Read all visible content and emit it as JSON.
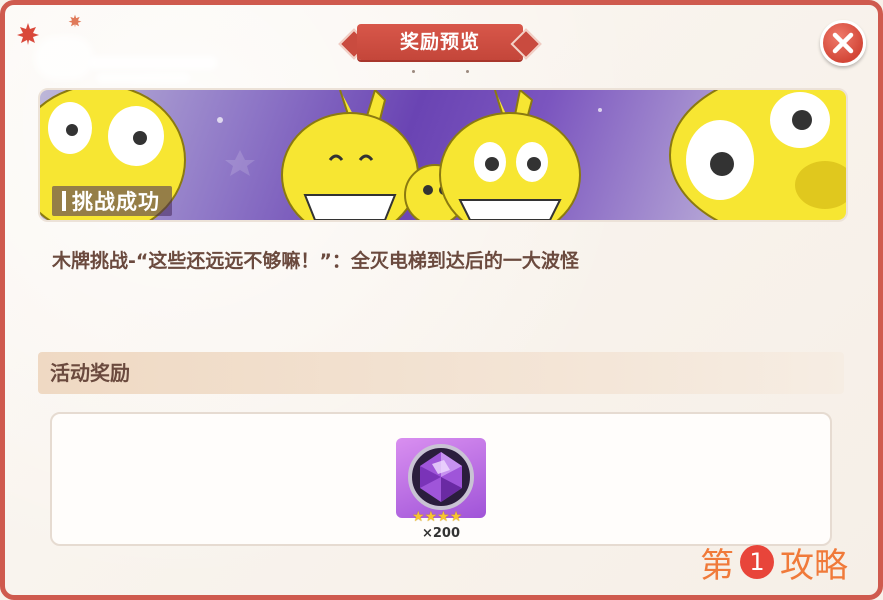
{
  "dialog": {
    "title": "奖励预览",
    "close_icon": "close-icon"
  },
  "banner": {
    "label": "挑战成功"
  },
  "description": "木牌挑战-“这些还远远不够嘛！”：全灭电梯到达后的一大波怪",
  "rewards_section": {
    "header": "活动奖励",
    "items": [
      {
        "icon": "purple-gem-icon",
        "stars": 4,
        "quantity": "×200"
      }
    ]
  },
  "watermark": {
    "prefix": "第",
    "number": "1",
    "suffix": "攻略"
  },
  "colors": {
    "frame_red": "#cf5a4e",
    "text_brown": "#6b4a3e",
    "star_gold": "#f7c530",
    "gem_purple": "#a054d8"
  }
}
